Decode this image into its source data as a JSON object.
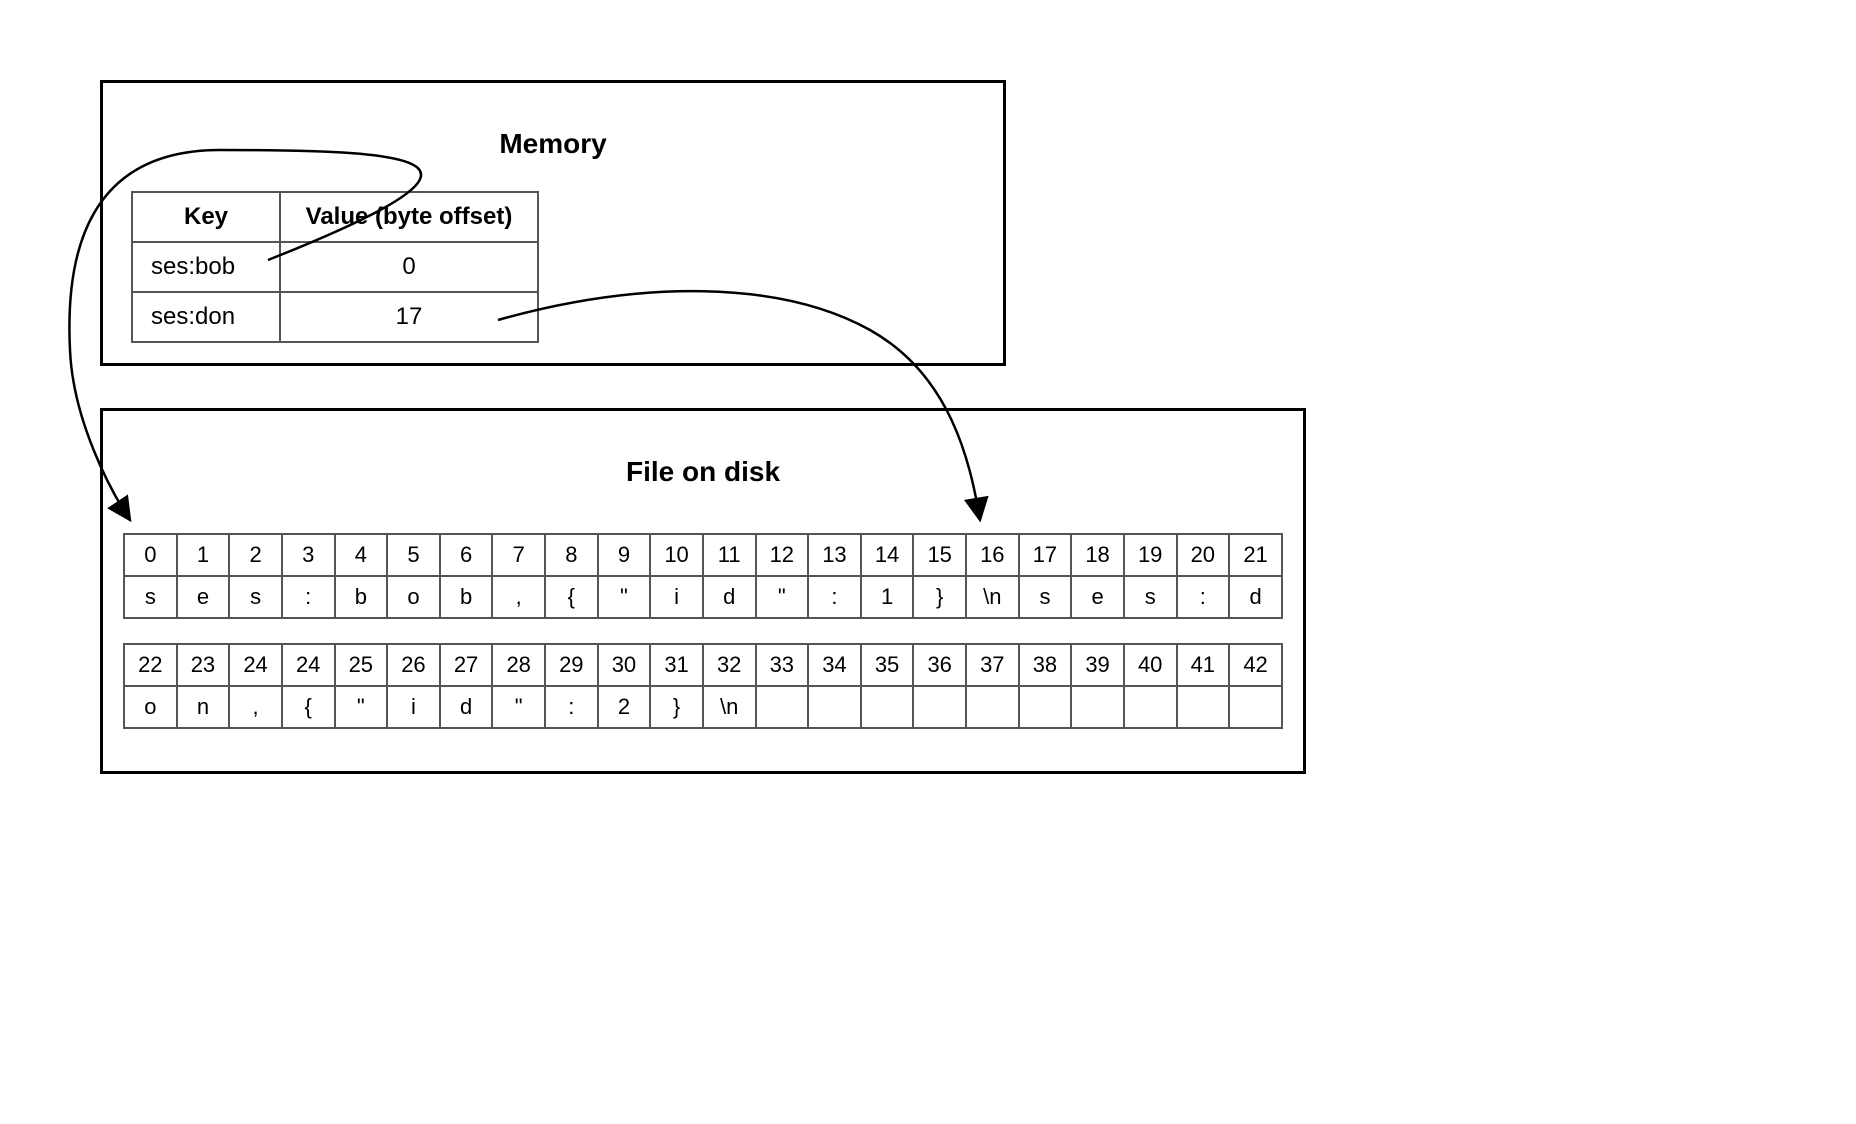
{
  "memory": {
    "title": "Memory",
    "columns": {
      "key": "Key",
      "value": "Value (byte offset)"
    },
    "rows": [
      {
        "key": "ses:bob",
        "value": "0"
      },
      {
        "key": "ses:don",
        "value": "17"
      }
    ]
  },
  "disk": {
    "title": "File on disk",
    "row1": {
      "offsets": [
        "0",
        "1",
        "2",
        "3",
        "4",
        "5",
        "6",
        "7",
        "8",
        "9",
        "10",
        "11",
        "12",
        "13",
        "14",
        "15",
        "16",
        "17",
        "18",
        "19",
        "20",
        "21"
      ],
      "chars": [
        "s",
        "e",
        "s",
        ":",
        "b",
        "o",
        "b",
        ",",
        "{",
        "\"",
        "i",
        "d",
        "\"",
        ":",
        "1",
        "}",
        "\\n",
        "s",
        "e",
        "s",
        ":",
        "d"
      ]
    },
    "row2": {
      "offsets": [
        "22",
        "23",
        "24",
        "24",
        "25",
        "26",
        "27",
        "28",
        "29",
        "30",
        "31",
        "32",
        "33",
        "34",
        "35",
        "36",
        "37",
        "38",
        "39",
        "40",
        "41",
        "42"
      ],
      "chars": [
        "o",
        "n",
        ",",
        "{",
        "\"",
        "i",
        "d",
        "\"",
        ":",
        "2",
        "}",
        "\\n",
        "",
        "",
        "",
        "",
        "",
        "",
        "",
        "",
        "",
        ""
      ]
    }
  }
}
